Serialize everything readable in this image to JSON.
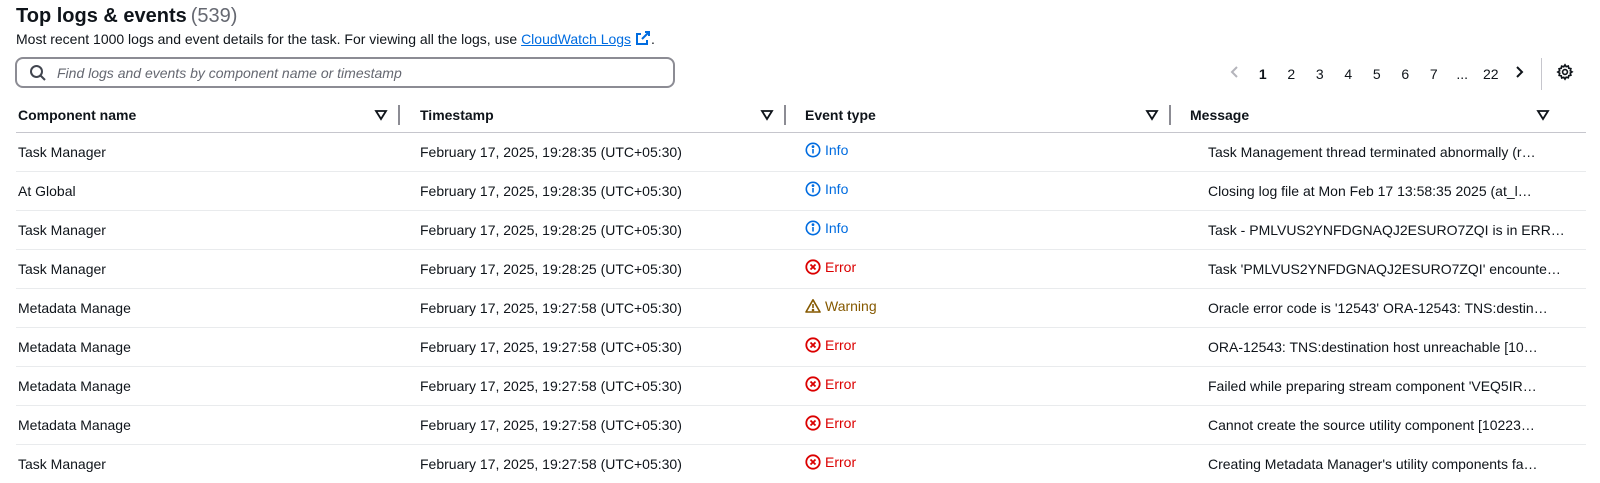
{
  "header": {
    "title": "Top logs & events",
    "count": "(539)",
    "description": "Most recent 1000 logs and event details for the task. For viewing all the logs, use",
    "link_label": "CloudWatch Logs",
    "description_end": "."
  },
  "search": {
    "placeholder": "Find logs and events by component name or timestamp",
    "value": ""
  },
  "pagination": {
    "pages": [
      "1",
      "2",
      "3",
      "4",
      "5",
      "6",
      "7",
      "...",
      "22"
    ],
    "current": "1"
  },
  "table": {
    "columns": [
      "Component name",
      "Timestamp",
      "Event type",
      "Message"
    ],
    "rows": [
      {
        "component": "Task Manager",
        "timestamp": "February 17, 2025, 19:28:35 (UTC+05:30)",
        "event": "Info",
        "message": "Task Management thread terminated abnormally  (r…"
      },
      {
        "component": "At Global",
        "timestamp": "February 17, 2025, 19:28:35 (UTC+05:30)",
        "event": "Info",
        "message": "Closing log file at Mon Feb 17 13:58:35 2025  (at_l…"
      },
      {
        "component": "Task Manager",
        "timestamp": "February 17, 2025, 19:28:25 (UTC+05:30)",
        "event": "Info",
        "message": "Task - PMLVUS2YNFDGNAQJ2ESURO7ZQI is in ERR…"
      },
      {
        "component": "Task Manager",
        "timestamp": "February 17, 2025, 19:28:25 (UTC+05:30)",
        "event": "Error",
        "message": "Task 'PMLVUS2YNFDGNAQJ2ESURO7ZQI' encounte…"
      },
      {
        "component": "Metadata Manage",
        "timestamp": "February 17, 2025, 19:27:58 (UTC+05:30)",
        "event": "Warning",
        "message": "Oracle error code is '12543' ORA-12543: TNS:destin…"
      },
      {
        "component": "Metadata Manage",
        "timestamp": "February 17, 2025, 19:27:58 (UTC+05:30)",
        "event": "Error",
        "message": "ORA-12543: TNS:destination host unreachable  [10…"
      },
      {
        "component": "Metadata Manage",
        "timestamp": "February 17, 2025, 19:27:58 (UTC+05:30)",
        "event": "Error",
        "message": "Failed while preparing stream component 'VEQ5IR…"
      },
      {
        "component": "Metadata Manage",
        "timestamp": "February 17, 2025, 19:27:58 (UTC+05:30)",
        "event": "Error",
        "message": "Cannot create the source utility component [10223…"
      },
      {
        "component": "Task Manager",
        "timestamp": "February 17, 2025, 19:27:58 (UTC+05:30)",
        "event": "Error",
        "message": "Creating Metadata Manager's utility components fa…"
      }
    ]
  },
  "colors": {
    "info": "#006ce0",
    "error": "#db0000",
    "warning": "#855900",
    "link": "#006ce0"
  },
  "icons": {
    "search": "search-icon",
    "external": "external-link-icon",
    "prev": "chevron-left-icon",
    "next": "chevron-right-icon",
    "settings": "gear-icon",
    "sort": "caret-down-icon",
    "info": "info-circle-icon",
    "error": "error-circle-icon",
    "warning": "warning-triangle-icon"
  }
}
